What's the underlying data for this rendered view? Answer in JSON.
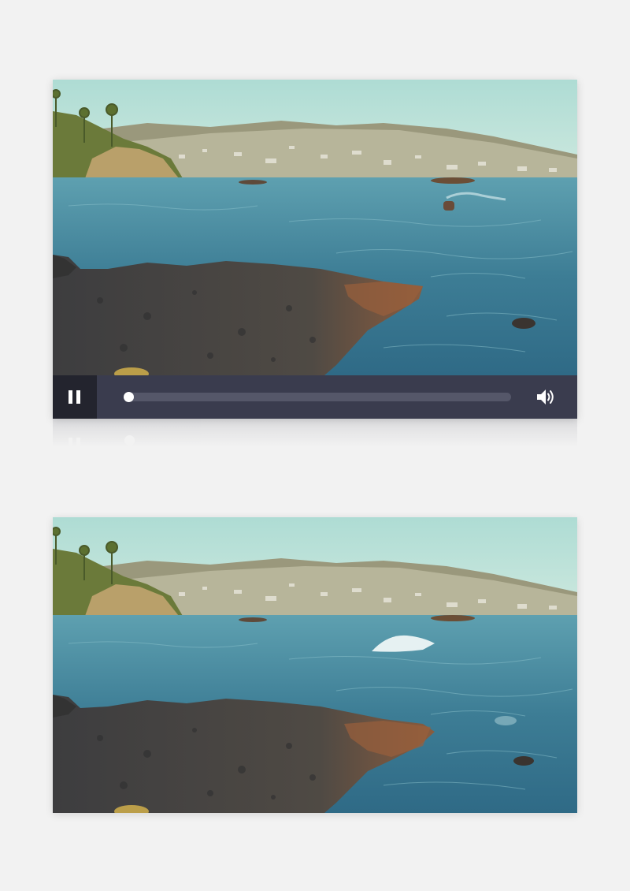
{
  "player": {
    "state": "playing",
    "progress": 0.0,
    "buttons": {
      "pause_icon": "pause-icon",
      "volume_icon": "speaker-volume-icon"
    },
    "colors": {
      "controls_bg": "#3a3c4e",
      "button_bg": "#23242e",
      "track": "#555769",
      "thumb": "#ffffff"
    }
  },
  "scene": {
    "sky": "#b8e0d6",
    "sea": "#3f7f96",
    "rock": "#4a4a48",
    "hills": "#8c8c70"
  }
}
